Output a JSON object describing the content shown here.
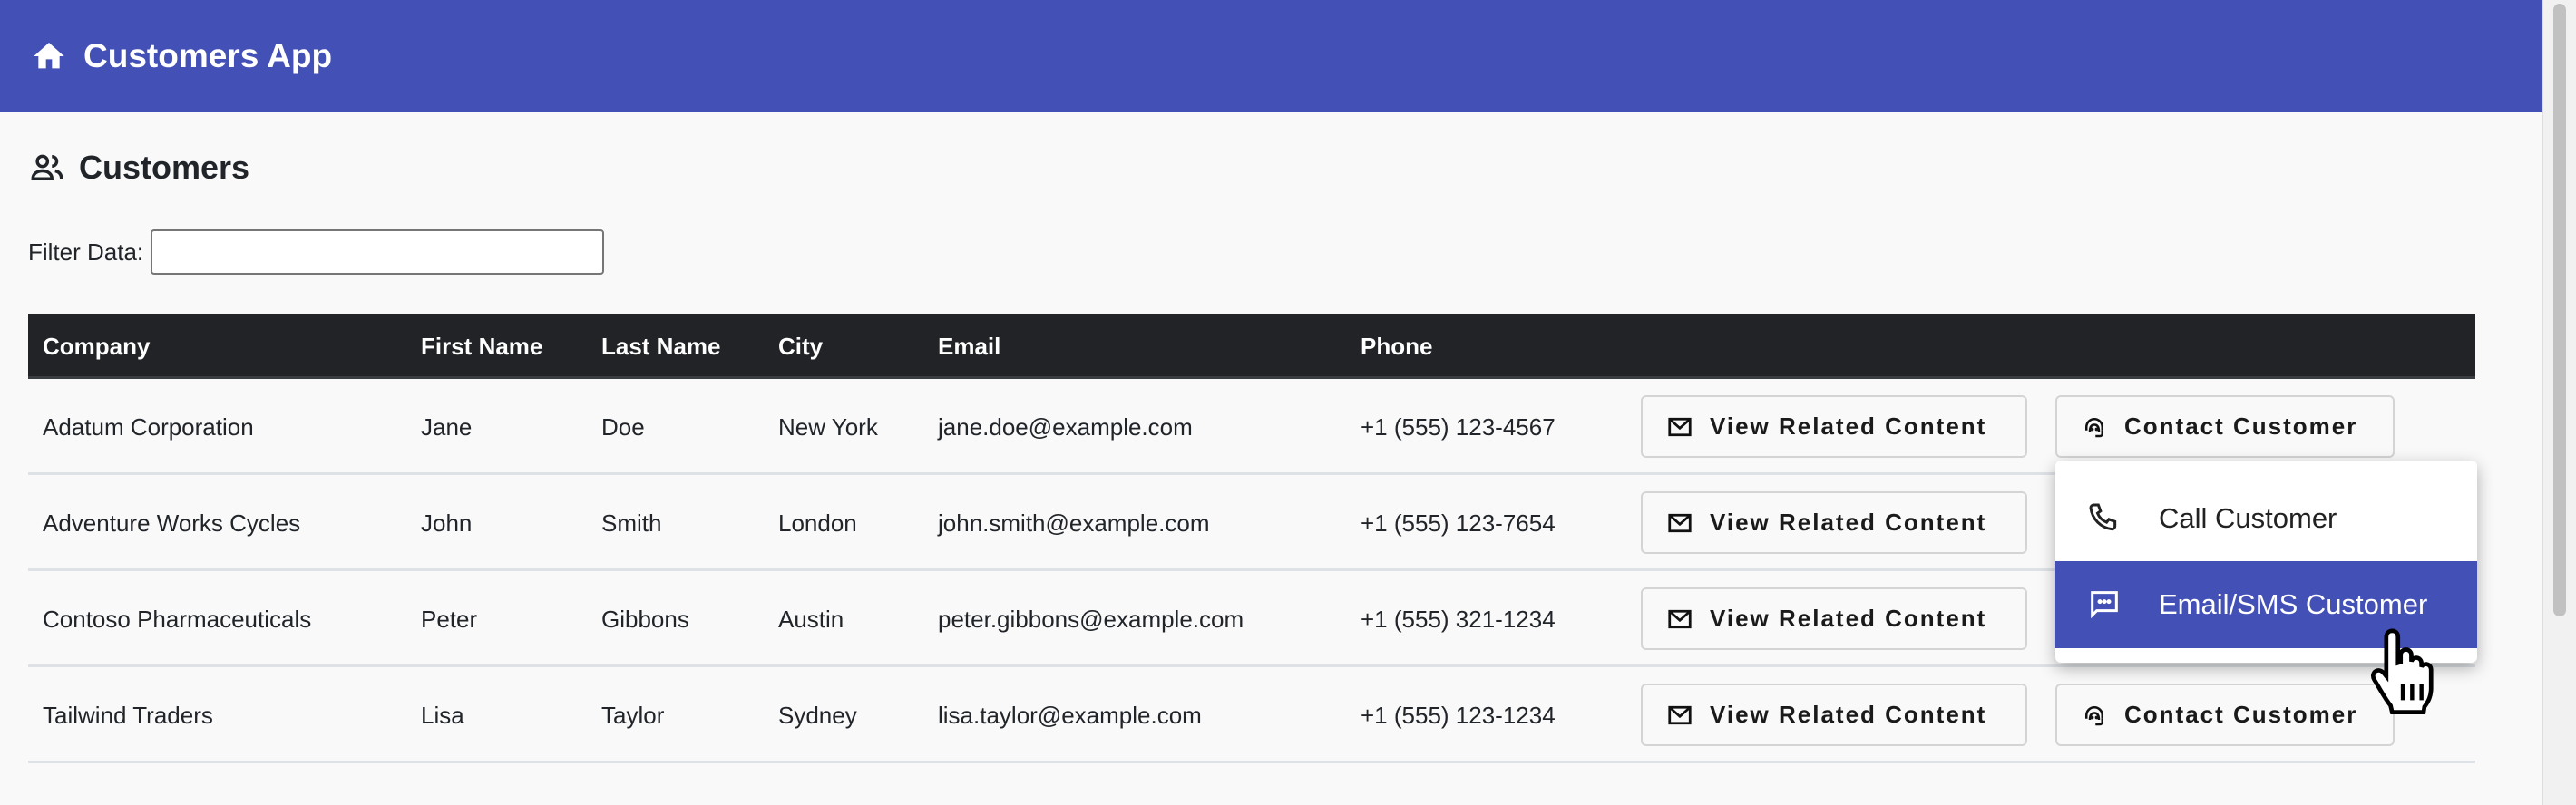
{
  "app": {
    "title": "Customers App",
    "icon": "home-icon",
    "accent": "#4351b7"
  },
  "page": {
    "title": "Customers",
    "icon": "people-icon"
  },
  "filter": {
    "label": "Filter Data:",
    "value": "",
    "placeholder": ""
  },
  "table": {
    "columns": [
      "Company",
      "First Name",
      "Last Name",
      "City",
      "Email",
      "Phone"
    ],
    "rows": [
      {
        "company": "Adatum Corporation",
        "first": "Jane",
        "last": "Doe",
        "city": "New York",
        "email": "jane.doe@example.com",
        "phone": "+1 (555) 123-4567"
      },
      {
        "company": "Adventure Works Cycles",
        "first": "John",
        "last": "Smith",
        "city": "London",
        "email": "john.smith@example.com",
        "phone": "+1 (555) 123-7654"
      },
      {
        "company": "Contoso Pharmaceuticals",
        "first": "Peter",
        "last": "Gibbons",
        "city": "Austin",
        "email": "peter.gibbons@example.com",
        "phone": "+1 (555) 321-1234"
      },
      {
        "company": "Tailwind Traders",
        "first": "Lisa",
        "last": "Taylor",
        "city": "Sydney",
        "email": "lisa.taylor@example.com",
        "phone": "+1 (555) 123-1234"
      }
    ],
    "view_label": "View Related Content",
    "contact_label": "Contact Customer"
  },
  "menu": {
    "items": [
      {
        "label": "Call Customer",
        "icon": "phone-icon"
      },
      {
        "label": "Email/SMS Customer",
        "icon": "chat-icon",
        "highlighted": true
      }
    ]
  }
}
